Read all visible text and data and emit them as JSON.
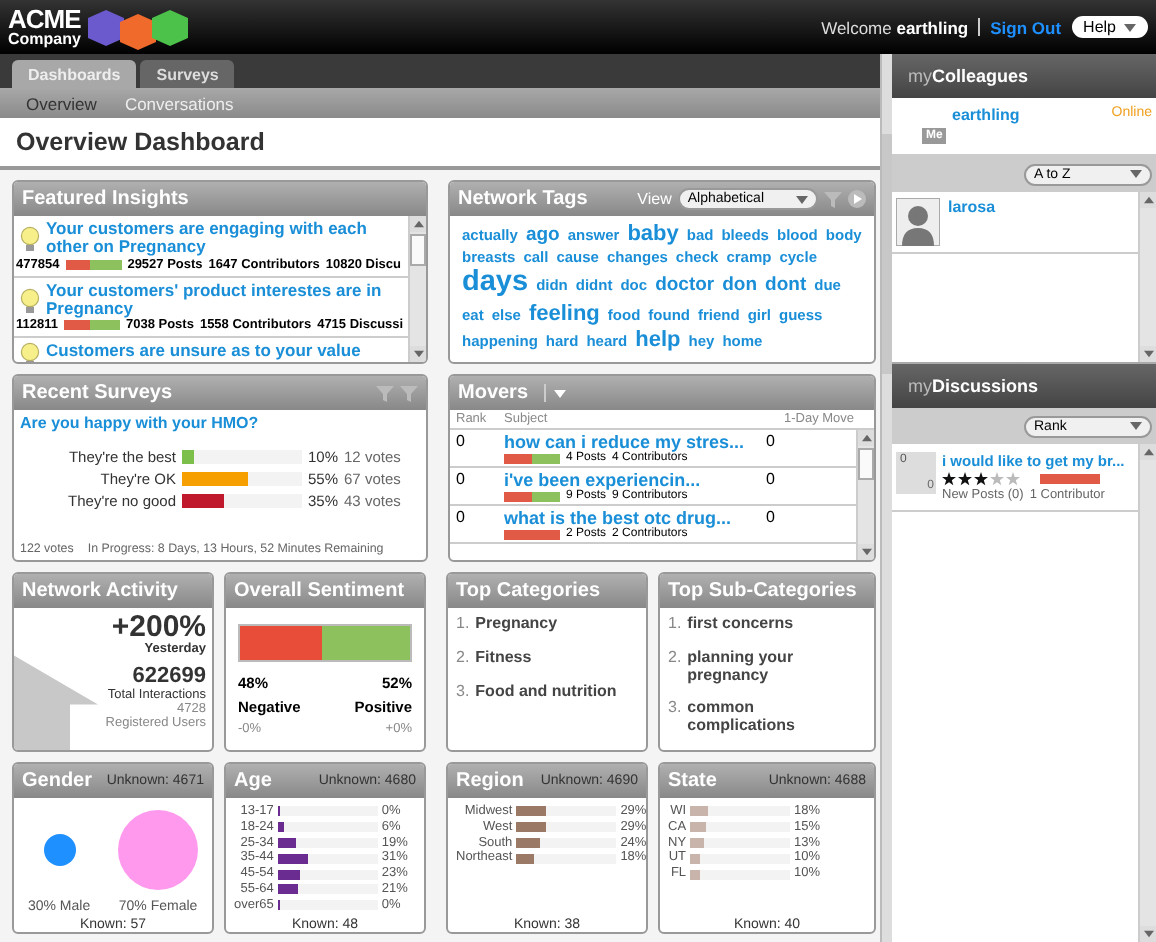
{
  "header": {
    "logo_line1": "ACME",
    "logo_line2": "Company",
    "welcome": "Welcome",
    "user": "earthling",
    "sign_out": "Sign Out",
    "help": "Help"
  },
  "tabs": [
    {
      "label": "Dashboards",
      "selected": true
    },
    {
      "label": "Surveys",
      "selected": false
    }
  ],
  "subnav": [
    {
      "label": "Overview",
      "selected": true
    },
    {
      "label": "Conversations",
      "selected": false
    }
  ],
  "page_title": "Overview Dashboard",
  "featured_insights": {
    "title": "Featured Insights",
    "items": [
      {
        "text": "Your customers are engaging with each other on Pregnancy",
        "score": "477854",
        "level": 0.45,
        "posts": "29527 Posts",
        "contributors": "1647 Contributors",
        "discussions": "10820 Discu"
      },
      {
        "text": "Your customers' product interestes are in Pregnancy",
        "score": "112811",
        "level": 0.45,
        "posts": "7038 Posts",
        "contributors": "1558 Contributors",
        "discussions": "4715 Discussi"
      },
      {
        "text": "Customers are unsure as to your value"
      }
    ]
  },
  "network_tags": {
    "title": "Network Tags",
    "view_label": "View",
    "view": "Alphabetical",
    "tags": [
      {
        "text": "actually",
        "kind": "small"
      },
      {
        "text": "ago",
        "kind": "medium"
      },
      {
        "text": "answer",
        "kind": "small"
      },
      {
        "text": "baby",
        "kind": "big"
      },
      {
        "text": "bad",
        "kind": "small"
      },
      {
        "text": "bleeds",
        "kind": "small"
      },
      {
        "text": "blood",
        "kind": "small"
      },
      {
        "text": "body",
        "kind": "small"
      },
      {
        "text": "breasts",
        "kind": "small"
      },
      {
        "text": "call",
        "kind": "small"
      },
      {
        "text": "cause",
        "kind": "small"
      },
      {
        "text": "changes",
        "kind": "small"
      },
      {
        "text": "check",
        "kind": "small"
      },
      {
        "text": "cramp",
        "kind": "small"
      },
      {
        "text": "cycle",
        "kind": "small"
      },
      {
        "text": "days",
        "kind": "huge"
      },
      {
        "text": "didn",
        "kind": "small"
      },
      {
        "text": "didnt",
        "kind": "small"
      },
      {
        "text": "doc",
        "kind": "small"
      },
      {
        "text": "doctor",
        "kind": "medium"
      },
      {
        "text": "don",
        "kind": "medium"
      },
      {
        "text": "dont",
        "kind": "medium"
      },
      {
        "text": "due",
        "kind": "small"
      },
      {
        "text": "eat",
        "kind": "small"
      },
      {
        "text": "else",
        "kind": "small"
      },
      {
        "text": "feeling",
        "kind": "big"
      },
      {
        "text": "food",
        "kind": "small"
      },
      {
        "text": "found",
        "kind": "small"
      },
      {
        "text": "friend",
        "kind": "small"
      },
      {
        "text": "girl",
        "kind": "small"
      },
      {
        "text": "guess",
        "kind": "small"
      },
      {
        "text": "happening",
        "kind": "small"
      },
      {
        "text": "hard",
        "kind": "small"
      },
      {
        "text": "heard",
        "kind": "small"
      },
      {
        "text": "help",
        "kind": "big"
      },
      {
        "text": "hey",
        "kind": "small"
      },
      {
        "text": "home",
        "kind": "small"
      }
    ]
  },
  "recent_surveys": {
    "title": "Recent Surveys",
    "question": "Are you happy with your HMO?",
    "answers": [
      {
        "label": "They're the best",
        "color": "#7cbf4a",
        "level": 0.1,
        "percent": "10%",
        "votes": "12 votes"
      },
      {
        "label": "They're OK",
        "color": "#f5a000",
        "level": 0.55,
        "percent": "55%",
        "votes": "67 votes"
      },
      {
        "label": "They're no good",
        "color": "#c0182c",
        "level": 0.35,
        "percent": "35%",
        "votes": "43 votes"
      }
    ],
    "total": "122 votes",
    "status": "In Progress:  8 Days, 13 Hours, 52 Minutes Remaining"
  },
  "movers": {
    "title": "Movers",
    "columns": [
      "Rank",
      "Subject",
      "1-Day Move"
    ],
    "rows": [
      {
        "rank": "0",
        "subject": "how can i reduce my stres...",
        "level": 0.5,
        "posts": "4 Posts",
        "contributors": "4 Contributors",
        "move": "0"
      },
      {
        "rank": "0",
        "subject": "i've been experiencin...",
        "level": 0.5,
        "posts": "9 Posts",
        "contributors": "9 Contributors",
        "move": "0"
      },
      {
        "rank": "0",
        "subject": "what is the best otc drug...",
        "level": 1,
        "posts": "2 Posts",
        "contributors": "2 Contributors",
        "move": "0"
      }
    ]
  },
  "network_activity": {
    "title": "Network Activity",
    "change": "+200%",
    "change_label": "Yesterday",
    "interactions": "622699",
    "interactions_label": "Total Interactions",
    "users": "4728",
    "users_label": "Registered Users"
  },
  "sentiment": {
    "title": "Overall Sentiment",
    "level": 0.48,
    "negative": {
      "percent": "48%",
      "label": "Negative",
      "change": "-0%"
    },
    "positive": {
      "percent": "52%",
      "label": "Positive",
      "change": "+0%"
    }
  },
  "top_categories": {
    "title": "Top Categories",
    "items": [
      {
        "number": "1.",
        "text": "Pregnancy"
      },
      {
        "number": "2.",
        "text": "Fitness"
      },
      {
        "number": "3.",
        "text": "Food and nutrition"
      }
    ]
  },
  "top_subcategories": {
    "title": "Top Sub-Categories",
    "items": [
      {
        "number": "1.",
        "text": "first concerns"
      },
      {
        "number": "2.",
        "text": "planning your pregnancy"
      },
      {
        "number": "3.",
        "text": "common complications"
      }
    ]
  },
  "gender": {
    "title": "Gender",
    "unknown": "Unknown: 4671",
    "known": "Known: 57",
    "items": [
      {
        "label": "30% Male",
        "color": "#1e90ff",
        "kind": "small"
      },
      {
        "label": "70% Female",
        "color": "#ff99ee",
        "kind": "large"
      }
    ]
  },
  "demographics": [
    {
      "title": "Age",
      "unknown": "Unknown: 4680",
      "known": "Known: 48",
      "color": "#6a2c91",
      "rows": [
        {
          "label": "13-17",
          "value": "0%",
          "level": 0
        },
        {
          "label": "18-24",
          "value": "6%",
          "level": 0.06
        },
        {
          "label": "25-34",
          "value": "19%",
          "level": 0.19
        },
        {
          "label": "35-44",
          "value": "31%",
          "level": 0.31
        },
        {
          "label": "45-54",
          "value": "23%",
          "level": 0.23
        },
        {
          "label": "55-64",
          "value": "21%",
          "level": 0.21
        },
        {
          "label": "over65",
          "value": "0%",
          "level": 0
        }
      ]
    },
    {
      "title": "Region",
      "unknown": "Unknown: 4690",
      "known": "Known: 38",
      "color": "#9a7a66",
      "rows": [
        {
          "label": "Midwest",
          "value": "29%",
          "level": 0.29
        },
        {
          "label": "West",
          "value": "29%",
          "level": 0.29
        },
        {
          "label": "South",
          "value": "24%",
          "level": 0.24
        },
        {
          "label": "Northeast",
          "value": "18%",
          "level": 0.18
        }
      ]
    },
    {
      "title": "State",
      "unknown": "Unknown: 4688",
      "known": "Known: 40",
      "color": "#c8b4aa",
      "rows": [
        {
          "label": "WI",
          "value": "18%",
          "level": 0.18
        },
        {
          "label": "CA",
          "value": "15%",
          "level": 0.15
        },
        {
          "label": "NY",
          "value": "13%",
          "level": 0.13
        },
        {
          "label": "UT",
          "value": "10%",
          "level": 0.1
        },
        {
          "label": "FL",
          "value": "10%",
          "level": 0.1
        }
      ]
    }
  ],
  "colleagues": {
    "title_prefix": "my",
    "title": "Colleagues",
    "me": {
      "name": "earthling",
      "status": "Online",
      "badge": "Me"
    },
    "sort": "A to Z",
    "people": [
      {
        "name": "larosa"
      }
    ]
  },
  "discussions": {
    "title_prefix": "my",
    "title": "Discussions",
    "sort": "Rank",
    "items": [
      {
        "count": "0",
        "badge_count": "0",
        "subject": "i would like to get my br...",
        "stars": 3,
        "level": 1,
        "new_posts": "New Posts (0)",
        "contributors": "1 Contributor"
      }
    ]
  }
}
